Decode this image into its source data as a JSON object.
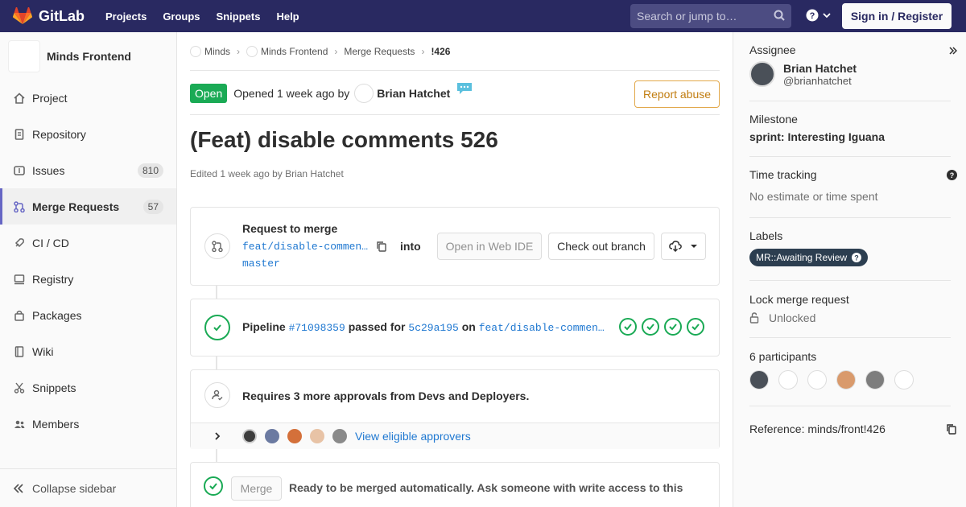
{
  "navbar": {
    "brand": "GitLab",
    "links": [
      "Projects",
      "Groups",
      "Snippets",
      "Help"
    ],
    "search_placeholder": "Search or jump to…",
    "signin_label": "Sign in / Register"
  },
  "sidebar": {
    "project_name": "Minds Frontend",
    "items": [
      {
        "label": "Project",
        "icon": "home-icon"
      },
      {
        "label": "Repository",
        "icon": "doc-icon"
      },
      {
        "label": "Issues",
        "icon": "issues-icon",
        "count": "810"
      },
      {
        "label": "Merge Requests",
        "icon": "merge-request-icon",
        "count": "57",
        "active": true
      },
      {
        "label": "CI / CD",
        "icon": "rocket-icon"
      },
      {
        "label": "Registry",
        "icon": "container-icon"
      },
      {
        "label": "Packages",
        "icon": "package-icon"
      },
      {
        "label": "Wiki",
        "icon": "book-icon"
      },
      {
        "label": "Snippets",
        "icon": "scissors-icon"
      },
      {
        "label": "Members",
        "icon": "users-icon"
      }
    ],
    "collapse_label": "Collapse sidebar"
  },
  "breadcrumb": [
    "Minds",
    "Minds Frontend",
    "Merge Requests",
    "!426"
  ],
  "mr": {
    "status": "Open",
    "opened_text": "Opened 1 week ago by",
    "author": "Brian Hatchet",
    "report_label": "Report abuse",
    "title": "(Feat) disable comments 526",
    "edited": "Edited 1 week ago by Brian Hatchet"
  },
  "merge_widget": {
    "request_label": "Request to merge",
    "source_branch": "feat/disable-commen…",
    "into": "into",
    "target_branch": "master",
    "web_ide_label": "Open in Web IDE",
    "checkout_label": "Check out branch"
  },
  "pipeline": {
    "prefix": "Pipeline",
    "id": "#71098359",
    "passed_for": "passed for",
    "commit": "5c29a195",
    "on": "on",
    "branch": "feat/disable-commen…",
    "stages_passed": 4
  },
  "approvals": {
    "text": "Requires 3 more approvals from Devs and Deployers.",
    "view_label": "View eligible approvers"
  },
  "merge": {
    "button_label": "Merge",
    "text": "Ready to be merged automatically. Ask someone with write access to this"
  },
  "right_sidebar": {
    "assignee_title": "Assignee",
    "assignee_name": "Brian Hatchet",
    "assignee_handle": "@brianhatchet",
    "milestone_title": "Milestone",
    "milestone_value": "sprint: Interesting Iguana",
    "time_title": "Time tracking",
    "time_value": "No estimate or time spent",
    "labels_title": "Labels",
    "label_value": "MR::Awaiting Review",
    "lock_title": "Lock merge request",
    "lock_value": "Unlocked",
    "participants_title": "6 participants",
    "reference": "Reference: minds/front!426"
  },
  "colors": {
    "navbar": "#292961",
    "success": "#1aaa55",
    "link": "#1f78d1",
    "warning": "#c17d10"
  }
}
